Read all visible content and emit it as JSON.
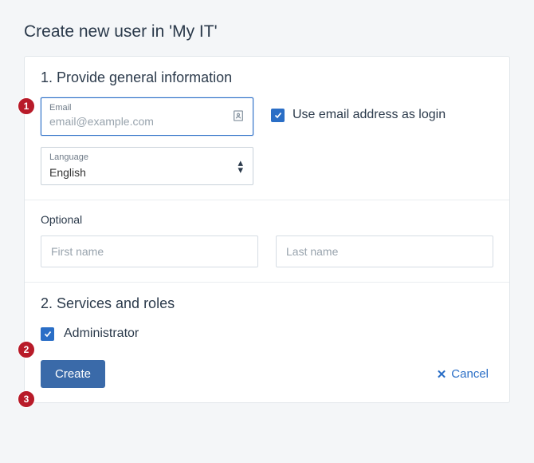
{
  "title": "Create new user in 'My IT'",
  "section1": {
    "heading": "1. Provide general information",
    "email_label": "Email",
    "email_placeholder": "email@example.com",
    "use_email_label": "Use email address as login",
    "use_email_checked": true,
    "language_label": "Language",
    "language_value": "English"
  },
  "optional": {
    "label": "Optional",
    "first_name_placeholder": "First name",
    "last_name_placeholder": "Last name"
  },
  "section2": {
    "heading": "2. Services and roles",
    "administrator_label": "Administrator",
    "administrator_checked": true
  },
  "footer": {
    "create_label": "Create",
    "cancel_label": "Cancel"
  },
  "markers": {
    "m1": "1",
    "m2": "2",
    "m3": "3"
  }
}
